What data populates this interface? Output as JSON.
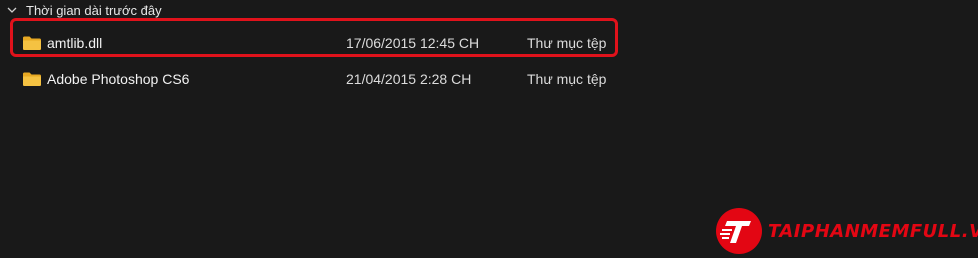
{
  "group": {
    "label": "Thời gian dài trước đây",
    "icon": "chevron-down-icon"
  },
  "files": [
    {
      "icon": "folder-icon",
      "name": "amtlib.dll",
      "date": "17/06/2015 12:45 CH",
      "type": "Thư mục tệp",
      "highlighted": true
    },
    {
      "icon": "folder-icon",
      "name": "Adobe Photoshop CS6",
      "date": "21/04/2015 2:28 CH",
      "type": "Thư mục tệp",
      "highlighted": false
    }
  ],
  "watermark": {
    "text": "TAIPHANMEMFULL.VN",
    "color": "#e30613"
  },
  "colors": {
    "background": "#191919",
    "highlight_border": "#e0121b",
    "folder": "#f5c242"
  }
}
